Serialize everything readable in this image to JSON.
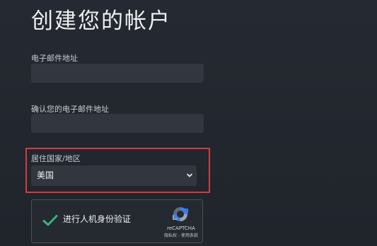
{
  "page": {
    "title": "创建您的帐户"
  },
  "form": {
    "email_label": "电子邮件地址",
    "email_value": "",
    "confirm_email_label": "确认您的电子邮件地址",
    "confirm_email_value": "",
    "country_label": "居住国家/地区",
    "country_value": "美国"
  },
  "captcha": {
    "text": "进行人机身份验证",
    "brand": "reCAPTCHA",
    "links": "隐私权 - 使用条款",
    "icon": "recaptcha-icon",
    "check_icon": "checkmark-icon"
  },
  "colors": {
    "background": "#22262d",
    "field": "#32363e",
    "highlight": "#d63a3f",
    "check": "#36b37e"
  }
}
